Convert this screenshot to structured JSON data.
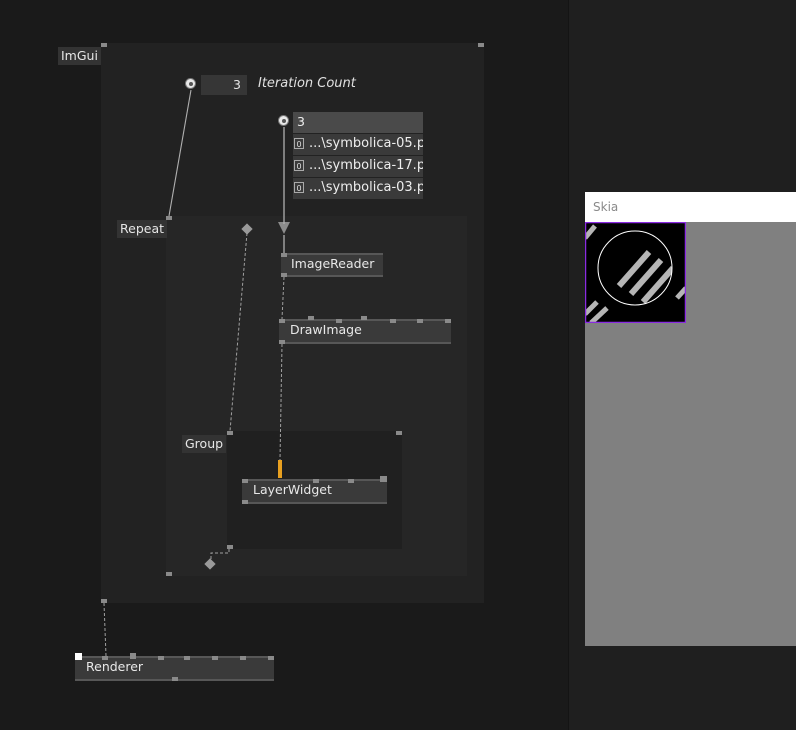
{
  "regions": {
    "imgui": "ImGui",
    "repeat": "Repeat",
    "group": "Group"
  },
  "iteration": {
    "value": "3",
    "label": "Iteration Count"
  },
  "spread": {
    "count": "3",
    "items": [
      {
        "index": "0",
        "text": "...\\symbolica-05.p"
      },
      {
        "index": "0",
        "text": "...\\symbolica-17.p"
      },
      {
        "index": "0",
        "text": "...\\symbolica-03.p"
      }
    ]
  },
  "nodes": {
    "image_reader": "ImageReader",
    "draw_image": "DrawImage",
    "layer_widget": "LayerWidget",
    "renderer": "Renderer"
  },
  "skia": {
    "title": "Skia"
  },
  "colors": {
    "accent": "#e8a020",
    "selection": "#8a2be2",
    "link": "#9a9a9a"
  },
  "icons": {
    "io_pin": "radio-dot-icon",
    "pad": "diamond-icon",
    "cursor": "down-triangle-icon"
  }
}
